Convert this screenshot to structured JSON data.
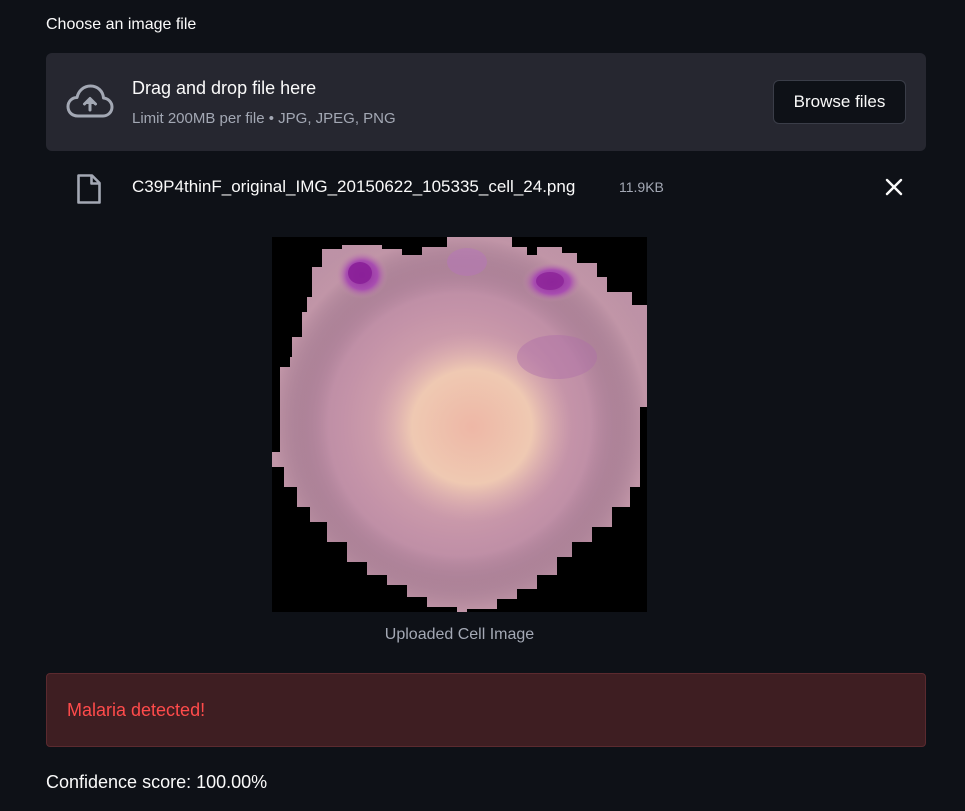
{
  "uploader": {
    "label": "Choose an image file",
    "drop_title": "Drag and drop file here",
    "drop_subtitle": "Limit 200MB per file • JPG, JPEG, PNG",
    "browse_label": "Browse files",
    "icon": "cloud-upload-icon"
  },
  "file": {
    "name": "C39P4thinF_original_IMG_20150622_105335_cell_24.png",
    "size": "11.9KB",
    "icon": "file-icon",
    "remove_icon": "close-icon"
  },
  "image": {
    "caption": "Uploaded Cell Image"
  },
  "result": {
    "alert": "Malaria detected!",
    "confidence": "Confidence score: 100.00%"
  },
  "colors": {
    "background": "#0e1117",
    "dropzone": "#262730",
    "alert_bg": "#3e1e22",
    "alert_text": "#ff4b4b"
  }
}
